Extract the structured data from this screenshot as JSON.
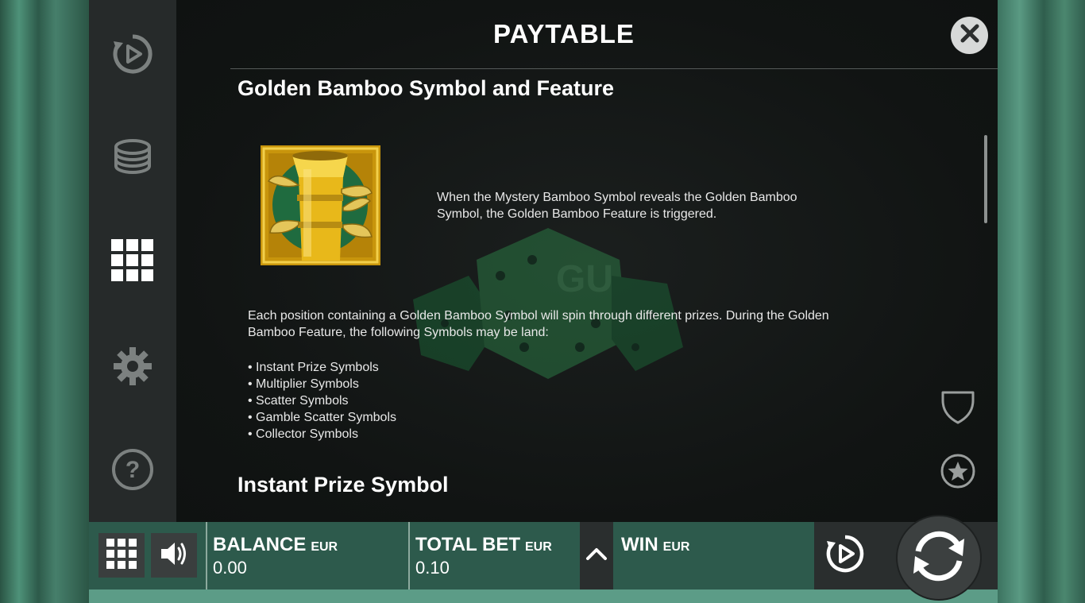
{
  "panel": {
    "title": "PAYTABLE",
    "close_icon": "close-icon"
  },
  "section1": {
    "heading": "Golden Bamboo Symbol and Feature",
    "symbol_name": "golden-bamboo-symbol",
    "description": "When the Mystery Bamboo Symbol reveals the Golden Bamboo Symbol, the Golden Bamboo Feature is triggered.",
    "desc_line1": "When the Mystery Bamboo Symbol reveals the Golden Bamboo",
    "desc_line2": "Symbol, the Golden Bamboo Feature is triggered.",
    "para_line1": "Each position containing a Golden Bamboo Symbol will spin through different prizes. During the Golden",
    "para_line2": "Bamboo Feature, the following Symbols may be land:",
    "bullets": [
      "• Instant Prize Symbols",
      "• Multiplier Symbols",
      "• Scatter Symbols",
      "• Gamble Scatter Symbols",
      "• Collector Symbols"
    ]
  },
  "section2": {
    "heading": "Instant Prize Symbol"
  },
  "left_menu": [
    "autoplay-icon",
    "coins-stack-icon",
    "grid-menu-icon",
    "gear-icon",
    "help-icon"
  ],
  "right_icons": [
    "shield-icon",
    "star-icon"
  ],
  "bottom_bar": {
    "balance_label": "BALANCE",
    "balance_currency": "EUR",
    "balance_value": "0.00",
    "total_bet_label": "TOTAL BET",
    "total_bet_currency": "EUR",
    "total_bet_value": "0.10",
    "win_label": "WIN",
    "win_currency": "EUR"
  },
  "colors": {
    "panel_bg": "#111413",
    "bar_bg": "#2d5a4c",
    "gold": "#d9a810",
    "accent_green": "#1f6b3f"
  }
}
